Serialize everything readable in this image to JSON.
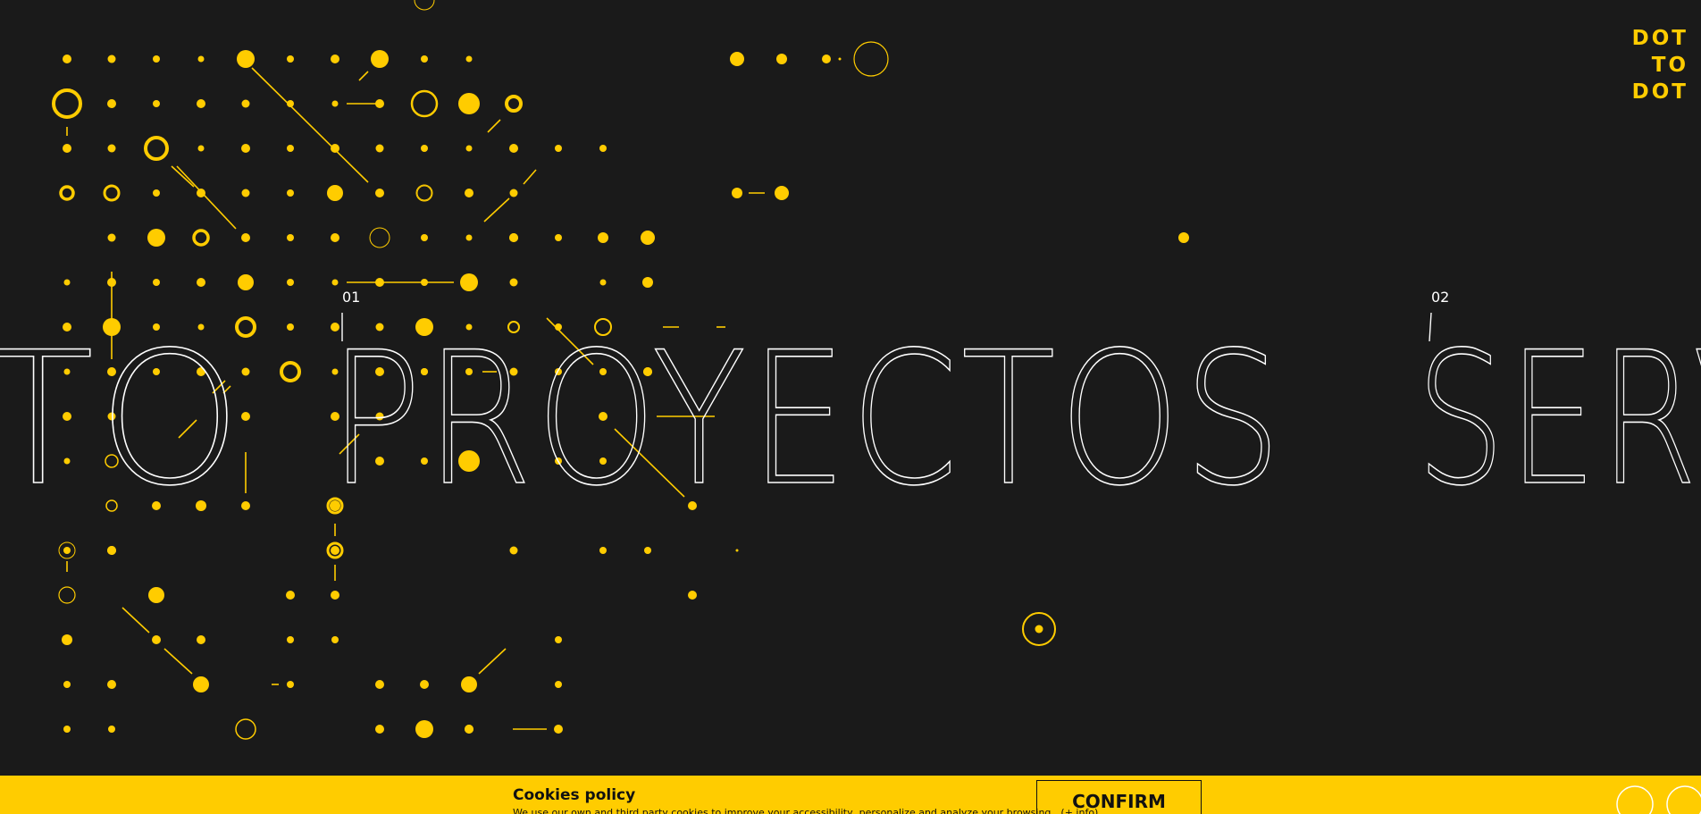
{
  "brand": {
    "logo_lines": [
      "DOT",
      "TO",
      "DOT"
    ],
    "accent_color": "#ffcc00",
    "background_color": "#1a1a1a"
  },
  "menu": {
    "items": [
      {
        "index": "",
        "label": "TO"
      },
      {
        "index": "01",
        "label": "PROYECTOS"
      },
      {
        "index": "02",
        "label": "SERV"
      }
    ]
  },
  "cookies": {
    "title": "Cookies policy",
    "text": "We use our own and third party cookies to improve your accessibility, personalize and analyze your browsing.",
    "more_label": "(+ info)",
    "confirm_label": "CONFIRM"
  },
  "icons": {
    "dots_pattern": "dot-grid-pattern",
    "corner": "circle-outline-icon"
  }
}
